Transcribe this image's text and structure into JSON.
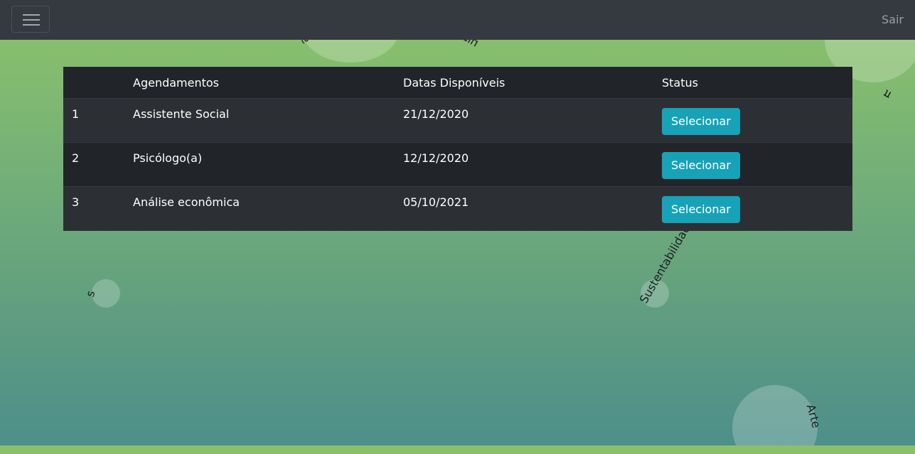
{
  "navbar": {
    "logout_label": "Sair"
  },
  "background": {
    "floating_words": [
      "sistên",
      "nizade",
      "Sustentabilidad",
      "Arte",
      "s",
      "π"
    ]
  },
  "table": {
    "headers": [
      "",
      "Agendamentos",
      "Datas Disponíveis",
      "Status"
    ],
    "rows": [
      {
        "num": "1",
        "agendamento": "Assistente Social",
        "data": "21/12/2020",
        "status_label": "Selecionar"
      },
      {
        "num": "2",
        "agendamento": "Psicólogo(a)",
        "data": "12/12/2020",
        "status_label": "Selecionar"
      },
      {
        "num": "3",
        "agendamento": "Análise econômica",
        "data": "05/10/2021",
        "status_label": "Selecionar"
      }
    ]
  },
  "colors": {
    "navbar": "#343a40",
    "table_dark": "#212529",
    "table_striped": "#2c3034",
    "button_info": "#17a2b8",
    "bg_top": "#88bf6d",
    "bg_bottom": "#4d8f8a"
  },
  "icons": [
    "hamburger-menu-icon"
  ]
}
